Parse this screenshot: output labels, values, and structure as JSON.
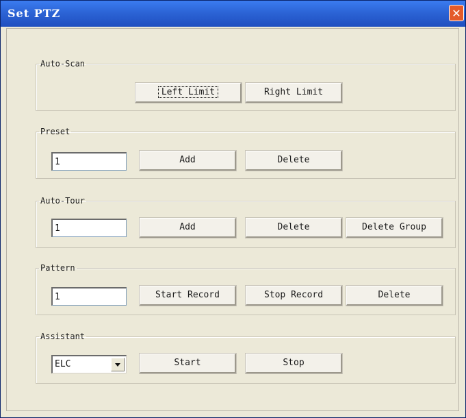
{
  "window": {
    "title": "Set PTZ",
    "close_glyph": "✕"
  },
  "auto_scan": {
    "title": "Auto-Scan",
    "left_limit_label": "Left Limit",
    "right_limit_label": "Right Limit"
  },
  "preset": {
    "title": "Preset",
    "value": "1",
    "add_label": "Add",
    "delete_label": "Delete"
  },
  "auto_tour": {
    "title": "Auto-Tour",
    "value": "1",
    "add_label": "Add",
    "delete_label": "Delete",
    "delete_group_label": "Delete Group"
  },
  "pattern": {
    "title": "Pattern",
    "value": "1",
    "start_record_label": "Start Record",
    "stop_record_label": "Stop Record",
    "delete_label": "Delete"
  },
  "assistant": {
    "title": "Assistant",
    "select_value": "ELC",
    "start_label": "Start",
    "stop_label": "Stop"
  }
}
